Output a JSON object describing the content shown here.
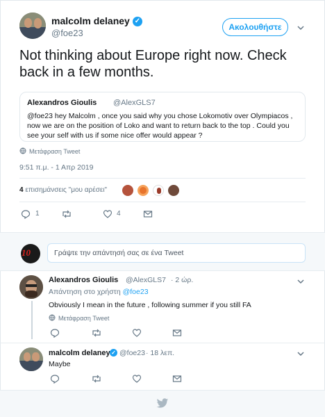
{
  "main_tweet": {
    "author_name": "malcolm delaney",
    "author_handle": "@foe23",
    "follow_label": "Ακολουθήστε",
    "text": "Not thinking about Europe right now. Check back in a few months.",
    "quoted": {
      "author_name": "Alexandros Gioulis",
      "author_handle": "@AlexGLS7",
      "text": "@foe23 hey Malcolm , once you said why you chose Lokomotiv over Olympiacos , now we are on the position of Loko and want to return back to the top . Could you see your self with us if some nice offer would appear ?"
    },
    "translate_label": "Μετάφραση Tweet",
    "timestamp": "9:51 π.μ. - 1 Απρ 2019",
    "likes_count": "4",
    "likes_label": "επισημάνσεις \"μου αρέσει\"",
    "reply_count": "1",
    "like_count": "4"
  },
  "composer": {
    "placeholder": "Γράψτε την απάντησή σας σε ένα Tweet",
    "avatar_text": "10"
  },
  "replies": [
    {
      "author_name": "Alexandros Gioulis",
      "author_handle": "@AlexGLS7",
      "time": "· 2 ώρ.",
      "reply_to_label": "Απάντηση στο χρήστη",
      "reply_to_handle": "@foe23",
      "text": "Obviously I mean in the future , following summer if you still FA",
      "translate_label": "Μετάφραση Tweet"
    },
    {
      "author_name": "malcolm delaney",
      "author_handle": "@foe23",
      "time": "· 18 λεπ.",
      "text": "Maybe"
    }
  ],
  "colors": {
    "accent": "#1da1f2",
    "secondary_text": "#657786",
    "primary_text": "#14171a",
    "border": "#e6ecf0",
    "background_alt": "#f5f8fa"
  },
  "icons": [
    "verified-badge-icon",
    "chevron-down-icon",
    "globe-icon",
    "reply-icon",
    "retweet-icon",
    "heart-icon",
    "message-icon",
    "twitter-bird-icon"
  ]
}
